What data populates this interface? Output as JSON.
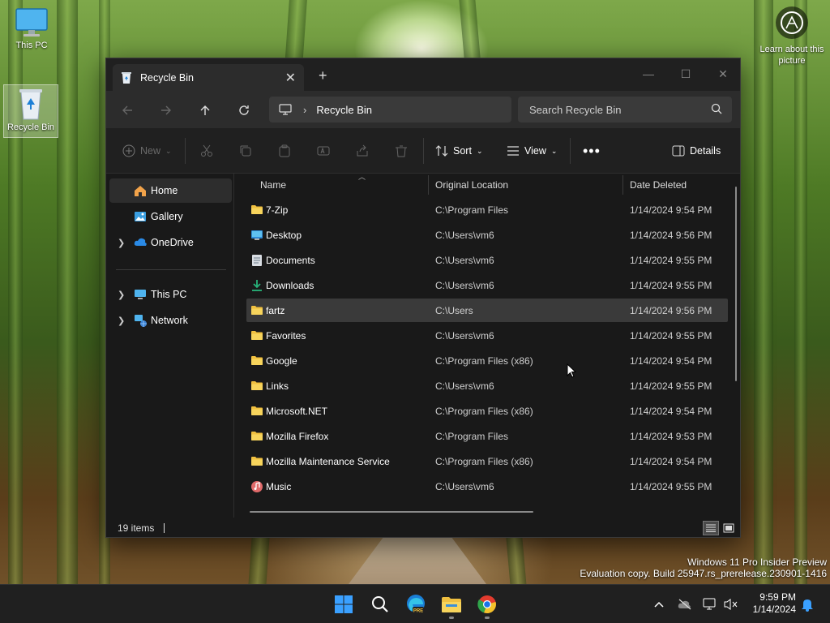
{
  "desktop": {
    "icons": [
      {
        "label": "This PC"
      },
      {
        "label": "Recycle Bin"
      }
    ],
    "learn_label": "Learn about this picture"
  },
  "window": {
    "tab_title": "Recycle Bin",
    "breadcrumb": "Recycle Bin",
    "search_placeholder": "Search Recycle Bin",
    "commands": {
      "new": "New",
      "sort": "Sort",
      "view": "View",
      "details": "Details"
    },
    "sidebar": [
      {
        "label": "Home",
        "icon": "home-icon",
        "selected": true
      },
      {
        "label": "Gallery",
        "icon": "gallery-icon"
      },
      {
        "label": "OneDrive",
        "icon": "cloud-icon"
      },
      {
        "label": "This PC",
        "icon": "computer-icon"
      },
      {
        "label": "Network",
        "icon": "network-icon"
      }
    ],
    "columns": {
      "name": "Name",
      "location": "Original Location",
      "date": "Date Deleted"
    },
    "files": [
      {
        "name": "7-Zip",
        "location": "C:\\Program Files",
        "date": "1/14/2024 9:54 PM",
        "icon": "folder-icon"
      },
      {
        "name": "Desktop",
        "location": "C:\\Users\\vm6",
        "date": "1/14/2024 9:56 PM",
        "icon": "desktop-folder-icon"
      },
      {
        "name": "Documents",
        "location": "C:\\Users\\vm6",
        "date": "1/14/2024 9:55 PM",
        "icon": "documents-folder-icon"
      },
      {
        "name": "Downloads",
        "location": "C:\\Users\\vm6",
        "date": "1/14/2024 9:55 PM",
        "icon": "downloads-folder-icon"
      },
      {
        "name": "fartz",
        "location": "C:\\Users",
        "date": "1/14/2024 9:56 PM",
        "icon": "folder-icon"
      },
      {
        "name": "Favorites",
        "location": "C:\\Users\\vm6",
        "date": "1/14/2024 9:55 PM",
        "icon": "folder-icon"
      },
      {
        "name": "Google",
        "location": "C:\\Program Files (x86)",
        "date": "1/14/2024 9:54 PM",
        "icon": "folder-icon"
      },
      {
        "name": "Links",
        "location": "C:\\Users\\vm6",
        "date": "1/14/2024 9:55 PM",
        "icon": "folder-icon"
      },
      {
        "name": "Microsoft.NET",
        "location": "C:\\Program Files (x86)",
        "date": "1/14/2024 9:54 PM",
        "icon": "folder-icon"
      },
      {
        "name": "Mozilla Firefox",
        "location": "C:\\Program Files",
        "date": "1/14/2024 9:53 PM",
        "icon": "folder-icon"
      },
      {
        "name": "Mozilla Maintenance Service",
        "location": "C:\\Program Files (x86)",
        "date": "1/14/2024 9:54 PM",
        "icon": "folder-icon"
      },
      {
        "name": "Music",
        "location": "C:\\Users\\vm6",
        "date": "1/14/2024 9:55 PM",
        "icon": "music-folder-icon"
      }
    ],
    "status": "19 items"
  },
  "watermark": {
    "line1": "Windows 11 Pro Insider Preview",
    "line2": "Evaluation copy. Build 25947.rs_prerelease.230901-1416"
  },
  "taskbar": {
    "time": "9:59 PM",
    "date": "1/14/2024",
    "edge_badge": "PRE"
  },
  "colors": {
    "folder": "#f0c040",
    "accent": "#4cc2ff",
    "window_bg": "#191919"
  }
}
